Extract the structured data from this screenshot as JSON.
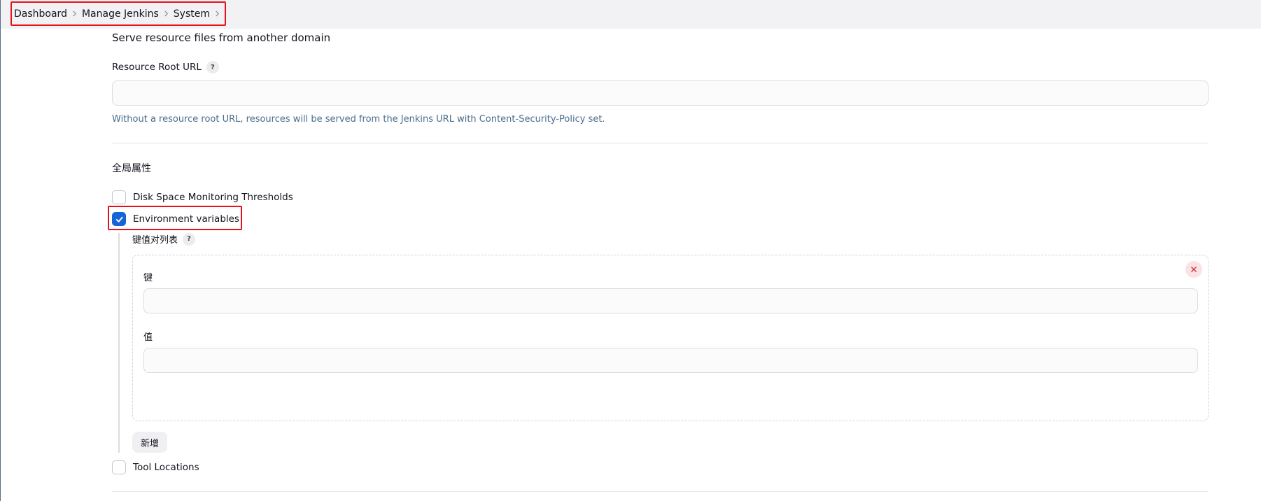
{
  "breadcrumb": {
    "items": [
      "Dashboard",
      "Manage Jenkins",
      "System"
    ]
  },
  "resource": {
    "section_title": "Serve resource files from another domain",
    "url_label": "Resource Root URL",
    "help": "?",
    "url_value": "",
    "hint": "Without a resource root URL, resources will be served from the Jenkins URL with Content-Security-Policy set."
  },
  "global_properties": {
    "title": "全局属性",
    "disk_space": {
      "label": "Disk Space Monitoring Thresholds",
      "checked": false
    },
    "env_vars": {
      "label": "Environment variables",
      "checked": true,
      "list_label": "键值对列表",
      "help": "?",
      "key_label": "键",
      "key_value": "",
      "value_label": "值",
      "value_value": "",
      "add_label": "新增"
    },
    "tool_locations": {
      "label": "Tool Locations",
      "checked": false
    }
  },
  "colors": {
    "accent": "#1565d8",
    "highlight": "#e5121b",
    "hint": "#4a6d8c"
  }
}
